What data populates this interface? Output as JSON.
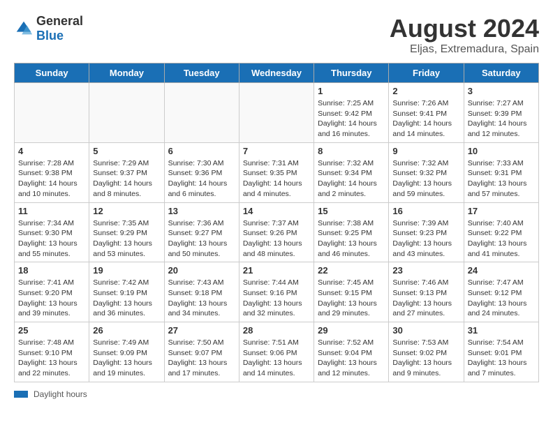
{
  "logo": {
    "text_general": "General",
    "text_blue": "Blue"
  },
  "title": "August 2024",
  "subtitle": "Eljas, Extremadura, Spain",
  "headers": [
    "Sunday",
    "Monday",
    "Tuesday",
    "Wednesday",
    "Thursday",
    "Friday",
    "Saturday"
  ],
  "legend_text": "Daylight hours",
  "weeks": [
    [
      {
        "day": "",
        "info": ""
      },
      {
        "day": "",
        "info": ""
      },
      {
        "day": "",
        "info": ""
      },
      {
        "day": "",
        "info": ""
      },
      {
        "day": "1",
        "info": "Sunrise: 7:25 AM\nSunset: 9:42 PM\nDaylight: 14 hours and 16 minutes."
      },
      {
        "day": "2",
        "info": "Sunrise: 7:26 AM\nSunset: 9:41 PM\nDaylight: 14 hours and 14 minutes."
      },
      {
        "day": "3",
        "info": "Sunrise: 7:27 AM\nSunset: 9:39 PM\nDaylight: 14 hours and 12 minutes."
      }
    ],
    [
      {
        "day": "4",
        "info": "Sunrise: 7:28 AM\nSunset: 9:38 PM\nDaylight: 14 hours and 10 minutes."
      },
      {
        "day": "5",
        "info": "Sunrise: 7:29 AM\nSunset: 9:37 PM\nDaylight: 14 hours and 8 minutes."
      },
      {
        "day": "6",
        "info": "Sunrise: 7:30 AM\nSunset: 9:36 PM\nDaylight: 14 hours and 6 minutes."
      },
      {
        "day": "7",
        "info": "Sunrise: 7:31 AM\nSunset: 9:35 PM\nDaylight: 14 hours and 4 minutes."
      },
      {
        "day": "8",
        "info": "Sunrise: 7:32 AM\nSunset: 9:34 PM\nDaylight: 14 hours and 2 minutes."
      },
      {
        "day": "9",
        "info": "Sunrise: 7:32 AM\nSunset: 9:32 PM\nDaylight: 13 hours and 59 minutes."
      },
      {
        "day": "10",
        "info": "Sunrise: 7:33 AM\nSunset: 9:31 PM\nDaylight: 13 hours and 57 minutes."
      }
    ],
    [
      {
        "day": "11",
        "info": "Sunrise: 7:34 AM\nSunset: 9:30 PM\nDaylight: 13 hours and 55 minutes."
      },
      {
        "day": "12",
        "info": "Sunrise: 7:35 AM\nSunset: 9:29 PM\nDaylight: 13 hours and 53 minutes."
      },
      {
        "day": "13",
        "info": "Sunrise: 7:36 AM\nSunset: 9:27 PM\nDaylight: 13 hours and 50 minutes."
      },
      {
        "day": "14",
        "info": "Sunrise: 7:37 AM\nSunset: 9:26 PM\nDaylight: 13 hours and 48 minutes."
      },
      {
        "day": "15",
        "info": "Sunrise: 7:38 AM\nSunset: 9:25 PM\nDaylight: 13 hours and 46 minutes."
      },
      {
        "day": "16",
        "info": "Sunrise: 7:39 AM\nSunset: 9:23 PM\nDaylight: 13 hours and 43 minutes."
      },
      {
        "day": "17",
        "info": "Sunrise: 7:40 AM\nSunset: 9:22 PM\nDaylight: 13 hours and 41 minutes."
      }
    ],
    [
      {
        "day": "18",
        "info": "Sunrise: 7:41 AM\nSunset: 9:20 PM\nDaylight: 13 hours and 39 minutes."
      },
      {
        "day": "19",
        "info": "Sunrise: 7:42 AM\nSunset: 9:19 PM\nDaylight: 13 hours and 36 minutes."
      },
      {
        "day": "20",
        "info": "Sunrise: 7:43 AM\nSunset: 9:18 PM\nDaylight: 13 hours and 34 minutes."
      },
      {
        "day": "21",
        "info": "Sunrise: 7:44 AM\nSunset: 9:16 PM\nDaylight: 13 hours and 32 minutes."
      },
      {
        "day": "22",
        "info": "Sunrise: 7:45 AM\nSunset: 9:15 PM\nDaylight: 13 hours and 29 minutes."
      },
      {
        "day": "23",
        "info": "Sunrise: 7:46 AM\nSunset: 9:13 PM\nDaylight: 13 hours and 27 minutes."
      },
      {
        "day": "24",
        "info": "Sunrise: 7:47 AM\nSunset: 9:12 PM\nDaylight: 13 hours and 24 minutes."
      }
    ],
    [
      {
        "day": "25",
        "info": "Sunrise: 7:48 AM\nSunset: 9:10 PM\nDaylight: 13 hours and 22 minutes."
      },
      {
        "day": "26",
        "info": "Sunrise: 7:49 AM\nSunset: 9:09 PM\nDaylight: 13 hours and 19 minutes."
      },
      {
        "day": "27",
        "info": "Sunrise: 7:50 AM\nSunset: 9:07 PM\nDaylight: 13 hours and 17 minutes."
      },
      {
        "day": "28",
        "info": "Sunrise: 7:51 AM\nSunset: 9:06 PM\nDaylight: 13 hours and 14 minutes."
      },
      {
        "day": "29",
        "info": "Sunrise: 7:52 AM\nSunset: 9:04 PM\nDaylight: 13 hours and 12 minutes."
      },
      {
        "day": "30",
        "info": "Sunrise: 7:53 AM\nSunset: 9:02 PM\nDaylight: 13 hours and 9 minutes."
      },
      {
        "day": "31",
        "info": "Sunrise: 7:54 AM\nSunset: 9:01 PM\nDaylight: 13 hours and 7 minutes."
      }
    ]
  ]
}
